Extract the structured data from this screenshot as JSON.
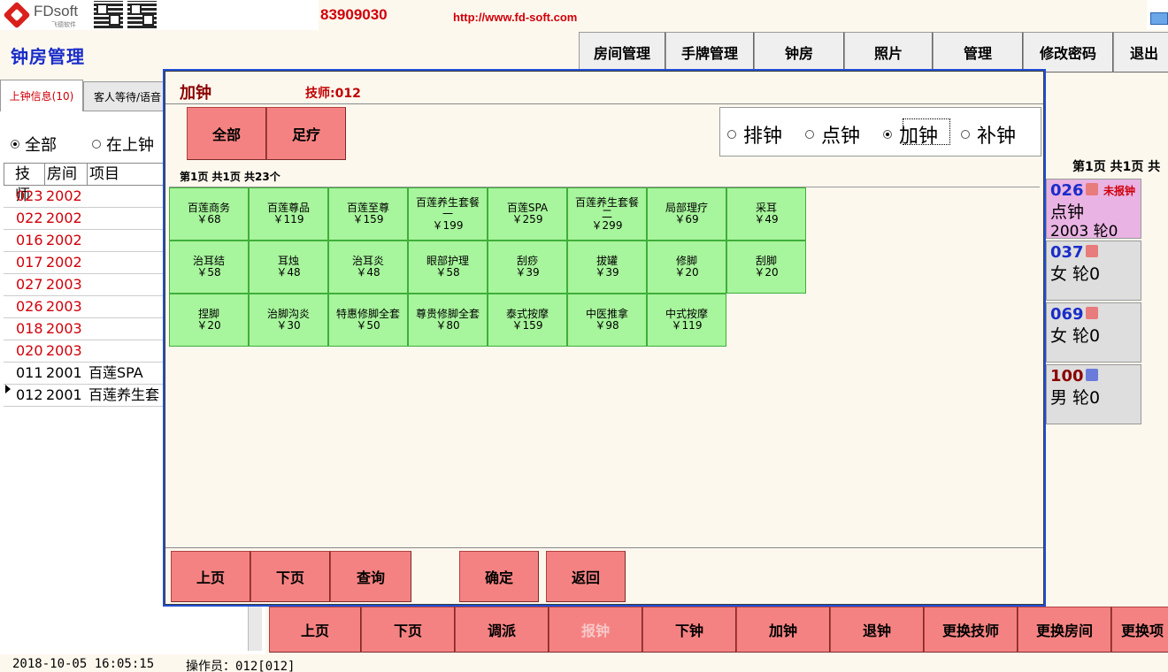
{
  "banner": {
    "brand": "FDsoft",
    "brand_sub": "飞德软件",
    "phone": "83909030",
    "url": "http://www.fd-soft.com"
  },
  "header": {
    "title": "钟房管理"
  },
  "nav": [
    "房间管理",
    "手牌管理",
    "钟房",
    "照片",
    "管理",
    "修改密码",
    "退出"
  ],
  "left": {
    "tabs": [
      "上钟信息(10)",
      "客人等待/语音"
    ],
    "filters": [
      {
        "label": "全部",
        "checked": true
      },
      {
        "label": "在上钟",
        "checked": false
      }
    ],
    "columns": [
      "技师",
      "房间",
      "项目"
    ],
    "rows": [
      {
        "tech": "023",
        "room": "2002",
        "project": "",
        "red": true
      },
      {
        "tech": "022",
        "room": "2002",
        "project": "",
        "red": true
      },
      {
        "tech": "016",
        "room": "2002",
        "project": "",
        "red": true
      },
      {
        "tech": "017",
        "room": "2002",
        "project": "",
        "red": true
      },
      {
        "tech": "027",
        "room": "2003",
        "project": "",
        "red": true
      },
      {
        "tech": "026",
        "room": "2003",
        "project": "",
        "red": true
      },
      {
        "tech": "018",
        "room": "2003",
        "project": "",
        "red": true
      },
      {
        "tech": "020",
        "room": "2003",
        "project": "",
        "red": true
      },
      {
        "tech": "011",
        "room": "2001",
        "project": "百莲SPA",
        "red": false
      },
      {
        "tech": "012",
        "room": "2001",
        "project": "百莲养生套",
        "red": false,
        "current": true
      }
    ]
  },
  "right": {
    "pager": "第1页  共1页  共",
    "cards": [
      {
        "num": "026",
        "line2": "点钟",
        "line3": "2003 轮0",
        "flag": "未报钟",
        "bg": "#E9B3E3",
        "num_color": "#1A2DC9",
        "face": "#E87B7B"
      },
      {
        "num": "037",
        "line2": "女 轮0",
        "line3": "",
        "flag": "",
        "bg": "#DEDEDE",
        "num_color": "#1A2DC9",
        "face": "#E87B7B"
      },
      {
        "num": "069",
        "line2": "女 轮0",
        "line3": "",
        "flag": "",
        "bg": "#DEDEDE",
        "num_color": "#1A2DC9",
        "face": "#E87B7B"
      },
      {
        "num": "100",
        "line2": "男 轮0",
        "line3": "",
        "flag": "",
        "bg": "#DEDEDE",
        "num_color": "#8A0000",
        "face": "#6A7BD9"
      }
    ]
  },
  "actions": [
    {
      "label": "上页",
      "disabled": false
    },
    {
      "label": "下页",
      "disabled": false
    },
    {
      "label": "调派",
      "disabled": false
    },
    {
      "label": "报钟",
      "disabled": true
    },
    {
      "label": "下钟",
      "disabled": false
    },
    {
      "label": "加钟",
      "disabled": false
    },
    {
      "label": "退钟",
      "disabled": false
    },
    {
      "label": "更换技师",
      "disabled": false
    },
    {
      "label": "更换房间",
      "disabled": false
    },
    {
      "label": "更换项",
      "disabled": false
    }
  ],
  "status": {
    "datetime": "2018-10-05 16:05:15",
    "operator": "操作员：012[012]"
  },
  "modal": {
    "title": "加钟",
    "tech": "技师:012",
    "categories": [
      "全部",
      "足疗"
    ],
    "modes": [
      {
        "label": "排钟",
        "checked": false
      },
      {
        "label": "点钟",
        "checked": false
      },
      {
        "label": "加钟",
        "checked": true
      },
      {
        "label": "补钟",
        "checked": false
      }
    ],
    "pager": "第1页  共1页  共23个",
    "services": [
      {
        "name": "百莲商务",
        "price": "￥68"
      },
      {
        "name": "百莲尊品",
        "price": "￥119"
      },
      {
        "name": "百莲至尊",
        "price": "￥159"
      },
      {
        "name": "百莲养生套餐一",
        "price": "￥199"
      },
      {
        "name": "百莲SPA",
        "price": "￥259"
      },
      {
        "name": "百莲养生套餐二",
        "price": "￥299"
      },
      {
        "name": "局部理疗",
        "price": "￥69"
      },
      {
        "name": "采耳",
        "price": "￥49"
      },
      {
        "name": "治耳结",
        "price": "￥58"
      },
      {
        "name": "耳烛",
        "price": "￥48"
      },
      {
        "name": "治耳炎",
        "price": "￥48"
      },
      {
        "name": "眼部护理",
        "price": "￥58"
      },
      {
        "name": "刮痧",
        "price": "￥39"
      },
      {
        "name": "拔罐",
        "price": "￥39"
      },
      {
        "name": "修脚",
        "price": "￥20"
      },
      {
        "name": "刮脚",
        "price": "￥20"
      },
      {
        "name": "捏脚",
        "price": "￥20"
      },
      {
        "name": "治脚沟炎",
        "price": "￥30"
      },
      {
        "name": "特惠修脚全套",
        "price": "￥50"
      },
      {
        "name": "尊贵修脚全套",
        "price": "￥80"
      },
      {
        "name": "泰式按摩",
        "price": "￥159"
      },
      {
        "name": "中医推拿",
        "price": "￥98"
      },
      {
        "name": "中式按摩",
        "price": "￥119"
      }
    ],
    "buttons": [
      "上页",
      "下页",
      "查询",
      "确定",
      "返回"
    ]
  }
}
